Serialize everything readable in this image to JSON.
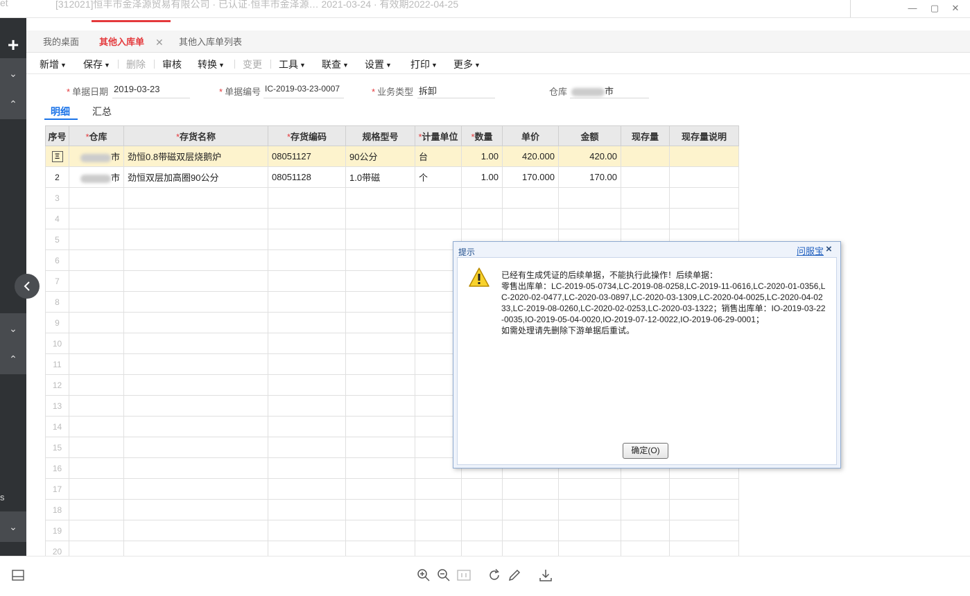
{
  "topbar": {
    "ghost_left": "et",
    "ghost_text": "[312021]恒丰市金泽源贸易有限公司 · 已认证·恒丰市金泽源…  2021-03-24 · 有效期2022-04-25"
  },
  "tabs": [
    {
      "label": "我的桌面"
    },
    {
      "label": "其他入库单"
    },
    {
      "label": "其他入库单列表"
    }
  ],
  "toolbar": {
    "items": [
      {
        "label": "新增",
        "caret": true,
        "disabled": false
      },
      {
        "label": "保存",
        "caret": true,
        "disabled": false
      },
      {
        "label": "删除",
        "caret": false,
        "disabled": true
      },
      {
        "label": "审核",
        "caret": false,
        "disabled": false
      },
      {
        "label": "转换",
        "caret": true,
        "disabled": false
      },
      {
        "label": "变更",
        "caret": false,
        "disabled": true
      },
      {
        "label": "工具",
        "caret": true,
        "disabled": false
      },
      {
        "label": "联查",
        "caret": true,
        "disabled": false
      },
      {
        "label": "设置",
        "caret": true,
        "disabled": false
      },
      {
        "label": "打印",
        "caret": true,
        "disabled": false
      },
      {
        "label": "更多",
        "caret": true,
        "disabled": false
      }
    ]
  },
  "form": {
    "date_label": "单据日期",
    "date_value": "2019-03-23",
    "code_label": "单据编号",
    "code_value": "IC-2019-03-23-0007",
    "type_label": "业务类型",
    "type_value": "拆卸",
    "warehouse_label": "仓库",
    "warehouse_suffix": "市"
  },
  "subtabs": [
    "明细",
    "汇总"
  ],
  "grid": {
    "columns": [
      "序号",
      "仓库",
      "存货名称",
      "存货编码",
      "规格型号",
      "计量单位",
      "数量",
      "单价",
      "金额",
      "现存量",
      "现存量说明"
    ],
    "required": [
      false,
      true,
      true,
      true,
      false,
      true,
      true,
      false,
      false,
      false,
      false
    ],
    "rows": [
      {
        "idx": "Ξ",
        "warehouse_suffix": "市",
        "name": "劲恒0.8带磁双层烧鹅炉",
        "code": "08051127",
        "spec": "90公分",
        "unit": "台",
        "qty": "1.00",
        "price": "420.000",
        "amount": "420.00",
        "stock": "",
        "stock_note": ""
      },
      {
        "idx": "2",
        "warehouse_suffix": "市",
        "name": "劲恒双层加高圈90公分",
        "code": "08051128",
        "spec": "1.0带磁",
        "unit": "个",
        "qty": "1.00",
        "price": "170.000",
        "amount": "170.00",
        "stock": "",
        "stock_note": ""
      }
    ],
    "empty_rows": [
      "3",
      "4",
      "5",
      "6",
      "7",
      "8",
      "9",
      "10",
      "11",
      "12",
      "13",
      "14",
      "15",
      "16",
      "17",
      "18",
      "19",
      "20"
    ]
  },
  "dialog": {
    "title": "提示",
    "help_link": "问服宝",
    "close": "×",
    "message": "已经有生成凭证的后续单据，不能执行此操作！后续单据：\n零售出库单：LC-2019-05-0734,LC-2019-08-0258,LC-2019-11-0616,LC-2020-01-0356,LC-2020-02-0477,LC-2020-03-0897,LC-2020-03-1309,LC-2020-04-0025,LC-2020-04-0233,LC-2019-08-0260,LC-2020-02-0253,LC-2020-03-1322；销售出库单：IO-2019-03-22-0035,IO-2019-05-04-0020,IO-2019-07-12-0022,IO-2019-06-29-0001；\n如需处理请先删除下游单据后重试。",
    "ok_label": "确定(O)"
  },
  "rail": {
    "letter": "s"
  },
  "colors": {
    "accent_red": "#e4393c",
    "accent_blue": "#1a73e8",
    "selected_row": "#fdf3cd",
    "rail": "#2f3235"
  }
}
